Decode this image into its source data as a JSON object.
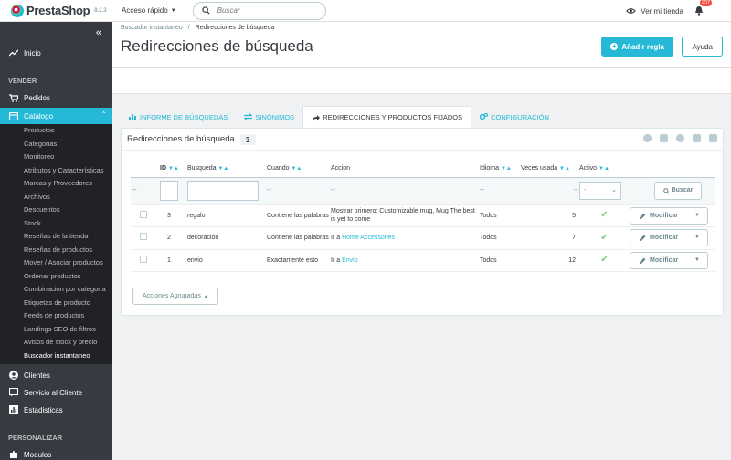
{
  "topbar": {
    "logo_text": "PrestaShop",
    "version": "8.2.3",
    "quick_access": "Acceso rápido",
    "search_placeholder": "Buscar",
    "view_store": "Ver mi tienda",
    "notifications": "207"
  },
  "sidebar": {
    "home": "Inicio",
    "sell_section": "VENDER",
    "orders": "Pedidos",
    "catalog": "Catalogo",
    "catalog_items": [
      "Productos",
      "Categorias",
      "Monitoreo",
      "Atributos y Características",
      "Marcas y Proveedores",
      "Archivos",
      "Descuentos",
      "Stock",
      "Reseñas de la tienda",
      "Reseñas de productos",
      "Mover / Asociar productos",
      "Ordenar productos",
      "Combinacion por categoria",
      "Etiquetas de producto",
      "Feeds de productos",
      "Landings SEO de filtros",
      "Avisos de stock y precio",
      "Buscador instantaneo"
    ],
    "customers": "Clientes",
    "service": "Servicio al Cliente",
    "stats": "Estadisticas",
    "personalize_section": "PERSONALIZAR",
    "modules": "Modulos"
  },
  "header": {
    "breadcrumb_parent": "Buscador instantaneo",
    "breadcrumb_sep": "/",
    "breadcrumb_current": "Redirecciones de búsqueda",
    "title": "Redirecciones de búsqueda",
    "add_button": "Añadir regla",
    "help_button": "Ayuda"
  },
  "tabs": [
    {
      "label": "INFORME DE BÚSQUEDAS"
    },
    {
      "label": "SINÓNIMOS"
    },
    {
      "label": "REDIRECCIONES Y PRODUCTOS FIJADOS"
    },
    {
      "label": "CONFIGURACIÓN"
    }
  ],
  "panel": {
    "title": "Redirecciones de búsqueda",
    "count": "3",
    "columns": {
      "id": "ID",
      "search": "Busqueda",
      "when": "Cuando",
      "action": "Accion",
      "language": "Idioma",
      "times_used": "Veces usada",
      "active": "Activo"
    },
    "filter": {
      "dash": "--",
      "active_select": "-",
      "search_button": "Buscar"
    },
    "rows": [
      {
        "id": "3",
        "search": "regalo",
        "when": "Contiene las palabras",
        "action_text": "Mostrar primero: Customizable mug, Mug The best is yet to come",
        "action_prefix": "",
        "action_link": "",
        "language": "Todos",
        "times": "5",
        "edit": "Modificar"
      },
      {
        "id": "2",
        "search": "decoración",
        "when": "Contiene las palabras",
        "action_text": "",
        "action_prefix": "Ir a",
        "action_link": "Home Accessories",
        "language": "Todos",
        "times": "7",
        "edit": "Modificar"
      },
      {
        "id": "1",
        "search": "envio",
        "when": "Exactamente esto",
        "action_text": "",
        "action_prefix": "Ir a",
        "action_link": "Envio",
        "language": "Todos",
        "times": "12",
        "edit": "Modificar"
      }
    ],
    "bulk": "Acciones Agrupadas"
  },
  "colors": {
    "accent": "#25b9d7",
    "sidebar": "#363a41",
    "sidebar_sub": "#202226",
    "success": "#78d07d",
    "badge": "#f54c3e"
  }
}
